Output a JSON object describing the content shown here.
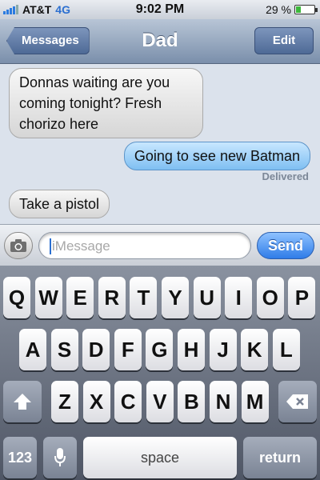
{
  "status": {
    "carrier": "AT&T",
    "network": "4G",
    "time": "9:02 PM",
    "battery_percent": "29 %",
    "battery_level": 0.29
  },
  "nav": {
    "back_label": "Messages",
    "title": "Dad",
    "edit_label": "Edit"
  },
  "messages": [
    {
      "direction": "incoming",
      "text": "Donnas waiting are you coming tonight?  Fresh chorizo here"
    },
    {
      "direction": "outgoing",
      "text": "Going to see new Batman"
    },
    {
      "direction": "incoming",
      "text": "Take a pistol"
    }
  ],
  "delivered_label": "Delivered",
  "input": {
    "placeholder": "iMessage",
    "send_label": "Send"
  },
  "keyboard": {
    "row1": [
      "Q",
      "W",
      "E",
      "R",
      "T",
      "Y",
      "U",
      "I",
      "O",
      "P"
    ],
    "row2": [
      "A",
      "S",
      "D",
      "F",
      "G",
      "H",
      "J",
      "K",
      "L"
    ],
    "row3": [
      "Z",
      "X",
      "C",
      "V",
      "B",
      "N",
      "M"
    ],
    "numbers_label": "123",
    "space_label": "space",
    "return_label": "return"
  },
  "colors": {
    "outgoing_bubble": "#7fbff2",
    "incoming_bubble": "#e4e4e4",
    "send_button": "#2f7ce8",
    "nav_bar": "#7a8fab"
  }
}
